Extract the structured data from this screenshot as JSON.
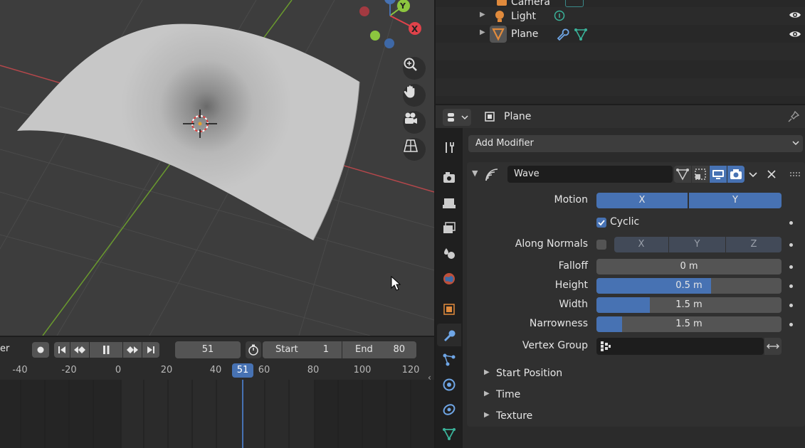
{
  "outliner": {
    "items": [
      {
        "label": "Camera"
      },
      {
        "label": "Light"
      },
      {
        "label": "Plane"
      }
    ]
  },
  "timeline": {
    "playback_label": "er",
    "current_frame": "51",
    "start_label": "Start",
    "start_value": "1",
    "end_label": "End",
    "end_value": "80",
    "ruler": [
      "-40",
      "-20",
      "0",
      "20",
      "40",
      "51",
      "60",
      "80",
      "100",
      "120"
    ]
  },
  "properties": {
    "object_name": "Plane",
    "add_modifier": "Add Modifier",
    "modifier_name": "Wave",
    "motion_label": "Motion",
    "motion_x": "X",
    "motion_y": "Y",
    "cyclic_label": "Cyclic",
    "along_normals_label": "Along Normals",
    "axis_x": "X",
    "axis_y": "Y",
    "axis_z": "Z",
    "falloff_label": "Falloff",
    "falloff_value": "0 m",
    "falloff_fill": 0.0,
    "height_label": "Height",
    "height_value": "0.5 m",
    "height_fill": 0.62,
    "width_label": "Width",
    "width_value": "1.5 m",
    "width_fill": 0.29,
    "narrowness_label": "Narrowness",
    "narrowness_value": "1.5 m",
    "narrowness_fill": 0.14,
    "vertex_group_label": "Vertex Group",
    "panels": [
      "Start Position",
      "Time",
      "Texture"
    ]
  },
  "colors": {
    "accent": "#4772b3",
    "axis_x": "#e0424a",
    "axis_y": "#8cc63f",
    "axis_z": "#4772b3"
  }
}
